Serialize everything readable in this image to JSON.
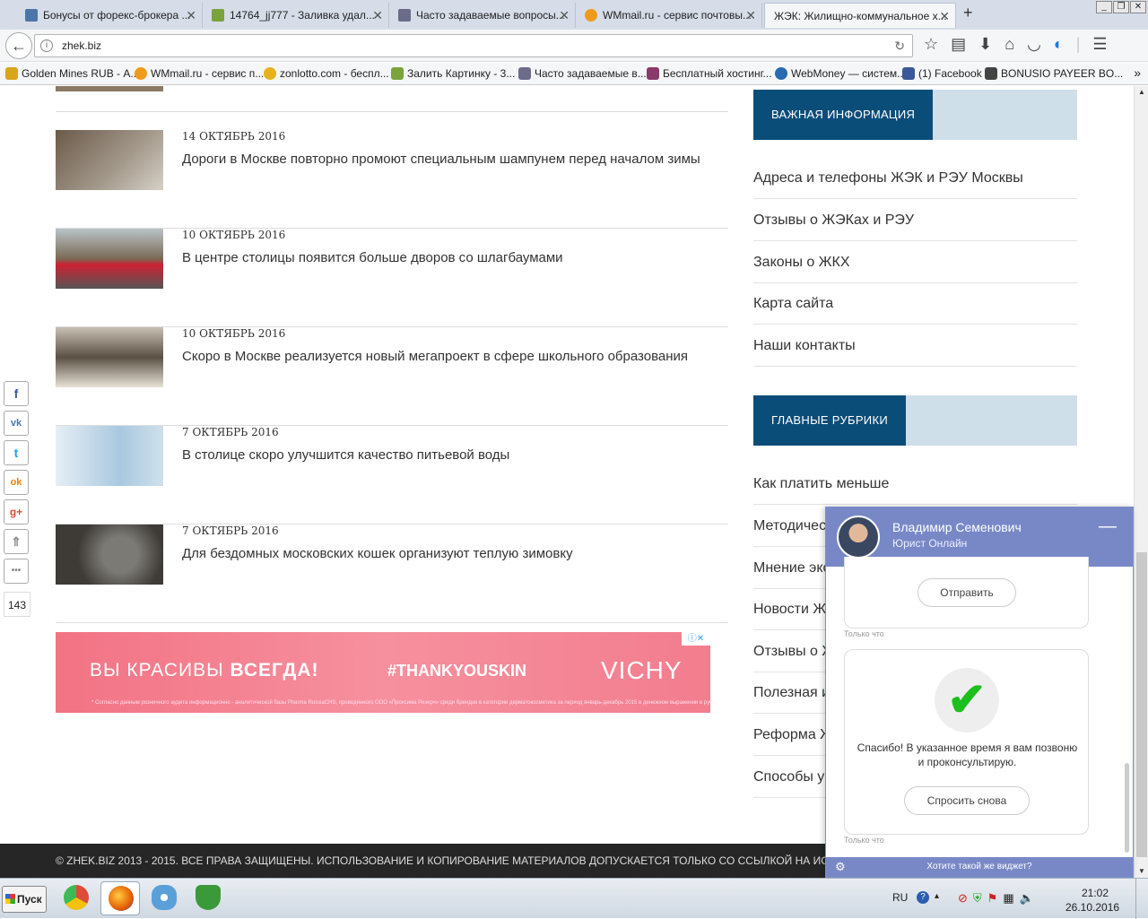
{
  "browser": {
    "tabs": [
      {
        "label": "Бонусы от форекс-брокера ...",
        "icon_color": "#4a76a8",
        "icon": "vk-icon"
      },
      {
        "label": "14764_jj777 - Заливка удал...",
        "icon_color": "#7aa33a",
        "icon": "image-icon"
      },
      {
        "label": "Часто задаваемые вопросы...",
        "icon_color": "#6b6b8a",
        "icon": "page-icon"
      },
      {
        "label": "WMmail.ru - сервис почтовы...",
        "icon_color": "#f09a1c",
        "icon": "wmmail-icon"
      },
      {
        "label": "ЖЭК: Жилищно-коммунальное х...",
        "icon_color": "#ffffff",
        "icon": "blank-icon"
      }
    ],
    "new_tab": "+",
    "url": "zhek.biz",
    "bookmarks": [
      {
        "label": "Golden Mines RUB - А...",
        "icon_color": "#d9a51c"
      },
      {
        "label": "WMmail.ru - сервис п...",
        "icon_color": "#f09a1c"
      },
      {
        "label": "zonlotto.com - беспл...",
        "icon_color": "#e8b21c"
      },
      {
        "label": "Залить Картинку - 3...",
        "icon_color": "#7aa33a"
      },
      {
        "label": "Часто задаваемые в...",
        "icon_color": "#6b6b8a"
      },
      {
        "label": "Бесплатный хостинг...",
        "icon_color": "#8a3a6a"
      },
      {
        "label": "WebMoney — систем...",
        "icon_color": "#2a6ab0"
      },
      {
        "label": "(1) Facebook",
        "icon_color": "#3b5998"
      },
      {
        "label": "BONUSIO PAYEER BO...",
        "icon_color": "#444444"
      }
    ]
  },
  "news": [
    {
      "date": "14 ОКТЯБРЬ 2016",
      "title": "Дороги в Москве повторно промоют специальным шампунем перед началом зимы",
      "thumb_color": "#6b5a4a"
    },
    {
      "date": "10 ОКТЯБРЬ 2016",
      "title": "В центре столицы появится больше дворов со шлагбаумами",
      "thumb_color": "#7a6a55"
    },
    {
      "date": "10 ОКТЯБРЬ 2016",
      "title": "Скоро в Москве реализуется новый мегапроект в сфере школьного образования",
      "thumb_color": "#5a5044"
    },
    {
      "date": "7 ОКТЯБРЬ 2016",
      "title": "В столице скоро улучшится качество питьевой воды",
      "thumb_color": "#a9c8df"
    },
    {
      "date": "7 ОКТЯБРЬ 2016",
      "title": "Для бездомных московских кошек организуют теплую зимовку",
      "thumb_color": "#3e3a36"
    }
  ],
  "ad": {
    "line1_a": "ВЫ КРАСИВЫ ",
    "line1_b": "ВСЕГДА!",
    "hashtag": "#THANKYOUSKIN",
    "brand": "VICHY",
    "fineprint": "* Согласно данным розничного аудита информационно - аналитической базы Pharmа RussiaCHS, проведенного ООО «Проксима Ризерч» среди брендов в категории дерматокосметика за период январь-декабрь 2015 в денежном выражении в руб.",
    "adchoices": "ⓘ✕"
  },
  "sidebar": {
    "important_title": "ВАЖНАЯ ИНФОРМАЦИЯ",
    "important_links": [
      "Адреса и телефоны ЖЭК и РЭУ Москвы",
      "Отзывы о ЖЭКах и РЭУ",
      "Законы о ЖКХ",
      "Карта сайта",
      "Наши контакты"
    ],
    "rubrics_title": "ГЛАВНЫЕ РУБРИКИ",
    "rubric_links": [
      "Как платить меньше",
      "Методичес",
      "Мнение экс",
      "Новости Ж",
      "Отзывы о Ж",
      "Полезная и",
      "Реформа Ж",
      "Способы у"
    ]
  },
  "share": {
    "buttons": [
      {
        "label": "f",
        "name": "facebook-share-button",
        "color": "#3b5998"
      },
      {
        "label": "vk",
        "name": "vk-share-button",
        "color": "#4a76a8"
      },
      {
        "label": "t",
        "name": "twitter-share-button",
        "color": "#1da1f2"
      },
      {
        "label": "ok",
        "name": "odnoklassniki-share-button",
        "color": "#ee8208"
      },
      {
        "label": "g+",
        "name": "google-plus-share-button",
        "color": "#dd4b39"
      },
      {
        "label": "⇑",
        "name": "scroll-top-button",
        "color": "#888888"
      },
      {
        "label": "•••",
        "name": "more-share-button",
        "color": "#888888"
      }
    ],
    "count": "143"
  },
  "footer": {
    "text": "© ZHEK.BIZ 2013 - 2015. ВСЕ ПРАВА ЗАЩИЩЕНЫ. ИСПОЛЬЗОВАНИЕ И КОПИРОВАНИЕ МАТЕРИАЛОВ ДОПУСКАЕТСЯ ТОЛЬКО СО ССЫЛКОЙ НА ИСТ"
  },
  "chat": {
    "agent_name": "Владимир Семенович",
    "agent_role": "Юрист Онлайн",
    "minimize": "—",
    "send_label": "Отправить",
    "timestamp1": "Только что",
    "thanks_message": "Спасибо! В указанное время я вам позвоню и проконсультирую.",
    "ask_again": "Спросить снова",
    "timestamp2": "Только что",
    "footer_text": "Хотите такой же виджет?",
    "check": "✔"
  },
  "taskbar": {
    "start": "Пуск",
    "apps": [
      {
        "name": "chrome-taskbar-button",
        "color": "#dd4b39"
      },
      {
        "name": "firefox-taskbar-button",
        "color": "#e66000"
      },
      {
        "name": "paint-taskbar-button",
        "color": "#5aa0d8"
      },
      {
        "name": "vpn-taskbar-button",
        "color": "#3a9a3a"
      }
    ],
    "lang": "RU",
    "help": "?",
    "time": "21:02",
    "date": "26.10.2016"
  },
  "colors": {
    "sidebar_header": "#0b4d79",
    "sidebar_header_bg": "#cfdfe9",
    "chat_accent": "#7888c7",
    "footer_bg": "#262626"
  }
}
